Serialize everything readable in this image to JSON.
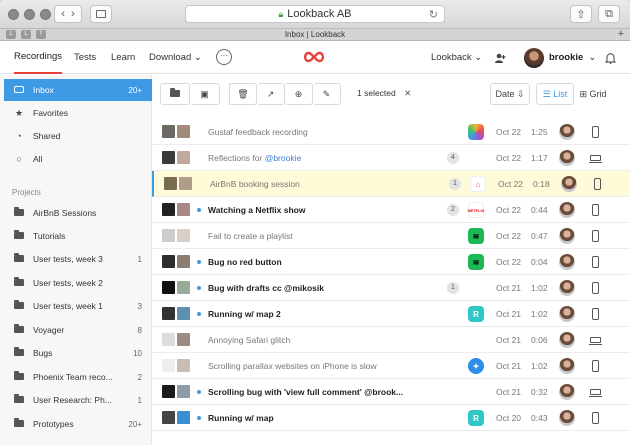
{
  "browser": {
    "url": "Lookback AB",
    "tab_title": "Inbox | Lookback",
    "favicons": [
      "L",
      "L",
      "f"
    ]
  },
  "header": {
    "nav": [
      {
        "label": "Recordings",
        "active": true
      },
      {
        "label": "Tests",
        "active": false
      },
      {
        "label": "Learn",
        "active": false
      },
      {
        "label": "Download ⌄",
        "active": false
      }
    ],
    "more": "···",
    "workspace": "Lookback ⌄",
    "user": "brookie",
    "user_chevron": "⌄"
  },
  "sidebar": {
    "items": [
      {
        "label": "Inbox",
        "count": "20+",
        "icon": "inbox-icon",
        "active": true
      },
      {
        "label": "Favorites",
        "count": "",
        "icon": "star-icon"
      },
      {
        "label": "Shared",
        "count": "",
        "icon": "shared-icon"
      },
      {
        "label": "All",
        "count": "",
        "icon": "circle-icon"
      }
    ],
    "projects_header": "Projects",
    "projects": [
      {
        "label": "AirBnB Sessions",
        "count": ""
      },
      {
        "label": "Tutorials",
        "count": ""
      },
      {
        "label": "User tests, week 3",
        "count": "1"
      },
      {
        "label": "User tests, week 2",
        "count": ""
      },
      {
        "label": "User tests, week 1",
        "count": "3"
      },
      {
        "label": "Voyager",
        "count": "8"
      },
      {
        "label": "Bugs",
        "count": "10"
      },
      {
        "label": "Phoenix Team reco...",
        "count": "2"
      },
      {
        "label": "User Research: Ph...",
        "count": "1"
      },
      {
        "label": "Prototypes",
        "count": "20+"
      }
    ]
  },
  "toolbar": {
    "selected_text": "1 selected",
    "clear": "✕",
    "sort_label": "Date ⇩",
    "list_label": "List",
    "grid_label": "Grid"
  },
  "rows": [
    {
      "title": "Gustaf feedback recording",
      "mention": "",
      "badge": "",
      "app": "photos",
      "date": "Oct 22",
      "duration": "1:25",
      "device": "phone",
      "unread": false,
      "selected": false
    },
    {
      "title": "Reflections for ",
      "mention": "@brookie",
      "badge": "4",
      "app": "",
      "date": "Oct 22",
      "duration": "1:17",
      "device": "laptop",
      "unread": false,
      "selected": false
    },
    {
      "title": "AirBnB booking session",
      "mention": "",
      "badge": "1",
      "app": "airbnb",
      "date": "Oct 22",
      "duration": "0:18",
      "device": "phone",
      "unread": false,
      "selected": true
    },
    {
      "title": "Watching a Netflix show",
      "mention": "",
      "badge": "2",
      "app": "netflix",
      "date": "Oct 22",
      "duration": "0:44",
      "device": "phone",
      "unread": true,
      "selected": false
    },
    {
      "title": "Fail to create a playlist",
      "mention": "",
      "badge": "",
      "app": "spotify",
      "date": "Oct 22",
      "duration": "0:47",
      "device": "phone",
      "unread": false,
      "selected": false
    },
    {
      "title": "Bug no red button",
      "mention": "",
      "badge": "",
      "app": "spotify",
      "date": "Oct 22",
      "duration": "0:04",
      "device": "phone",
      "unread": true,
      "selected": false
    },
    {
      "title": "Bug with drafts cc @mikosik",
      "mention": "",
      "badge": "1",
      "app": "",
      "date": "Oct 21",
      "duration": "1:02",
      "device": "phone",
      "unread": true,
      "selected": false
    },
    {
      "title": "Running w/ map 2",
      "mention": "",
      "badge": "",
      "app": "runkeeper",
      "date": "Oct 21",
      "duration": "1:02",
      "device": "phone",
      "unread": true,
      "selected": false
    },
    {
      "title": "Annoying Safari glitch",
      "mention": "",
      "badge": "",
      "app": "",
      "date": "Oct 21",
      "duration": "0:06",
      "device": "laptop",
      "unread": false,
      "selected": false
    },
    {
      "title": "Scrolling parallax websites on iPhone is slow",
      "mention": "",
      "badge": "",
      "app": "safari",
      "date": "Oct 21",
      "duration": "1:02",
      "device": "phone",
      "unread": false,
      "selected": false
    },
    {
      "title": "Scrolling bug with 'view full comment' @brook...",
      "mention": "",
      "badge": "",
      "app": "",
      "date": "Oct 21",
      "duration": "0:32",
      "device": "laptop",
      "unread": true,
      "selected": false
    },
    {
      "title": "Running w/ map",
      "mention": "",
      "badge": "",
      "app": "runkeeper",
      "date": "Oct 20",
      "duration": "0:43",
      "device": "phone",
      "unread": true,
      "selected": false
    }
  ],
  "colors": {
    "accent": "#3f9ae6",
    "brand_red": "#e8413b",
    "selected_row": "#fffbd8"
  }
}
